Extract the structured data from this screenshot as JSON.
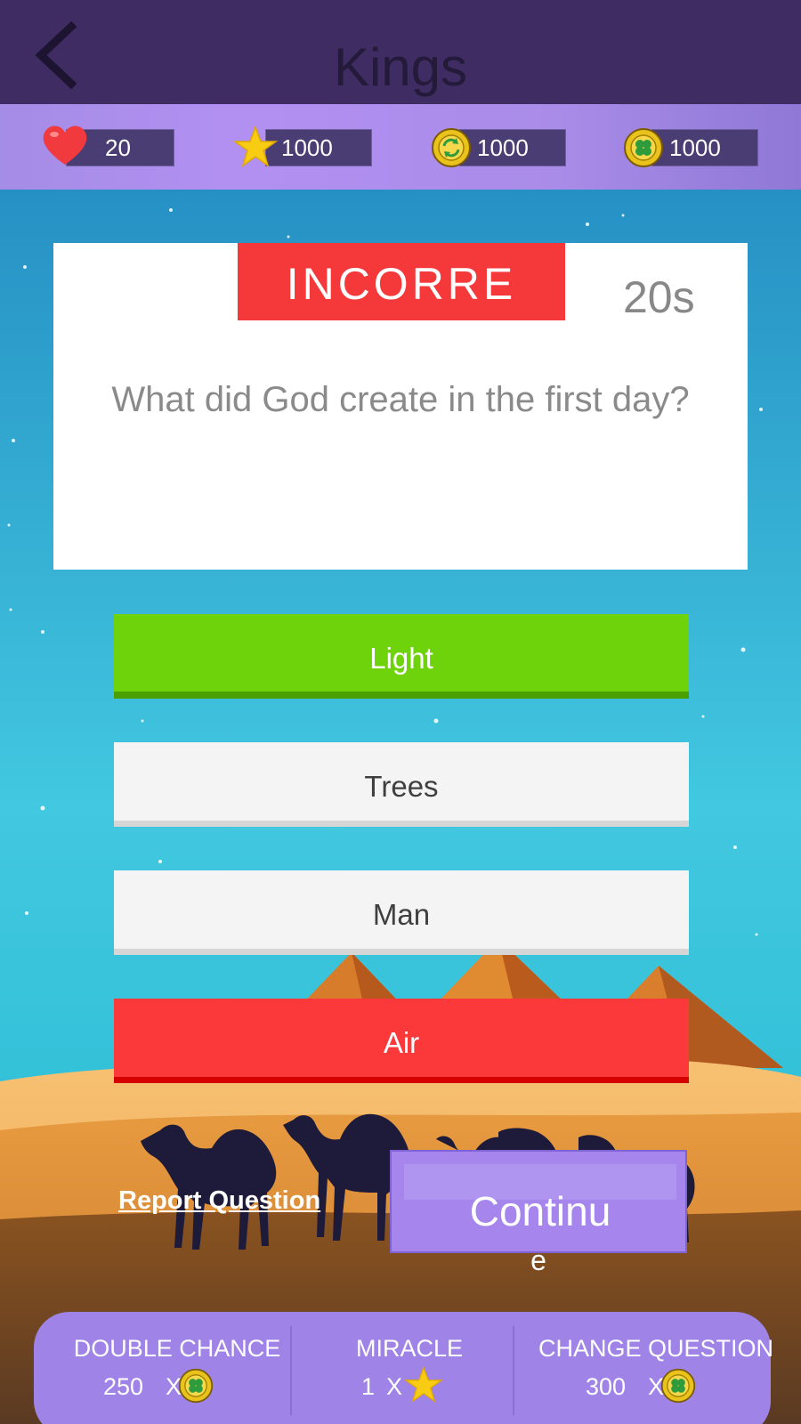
{
  "header": {
    "title": "Kings"
  },
  "stats": [
    {
      "icon": "heart-icon",
      "value": "20"
    },
    {
      "icon": "star-icon",
      "value": "1000"
    },
    {
      "icon": "refresh-coin-icon",
      "value": "1000"
    },
    {
      "icon": "clover-coin-icon",
      "value": "1000"
    }
  ],
  "question": {
    "verdict": "INCORRE",
    "timer": "20s",
    "text": "What did God create in the first day?"
  },
  "answers": [
    {
      "label": "Light",
      "state": "correct"
    },
    {
      "label": "Trees",
      "state": "neutral"
    },
    {
      "label": "Man",
      "state": "neutral"
    },
    {
      "label": "Air",
      "state": "wrong"
    }
  ],
  "actions": {
    "report_label": "Report Question",
    "continue_label": "Continu",
    "continue_overflow": "e"
  },
  "powerups": [
    {
      "name": "DOUBLE CHANCE",
      "cost": "250",
      "multiplier": "X",
      "icon": "clover-coin-icon"
    },
    {
      "name": "MIRACLE",
      "cost": "1",
      "multiplier": "X",
      "icon": "star-icon"
    },
    {
      "name": "CHANGE QUESTION",
      "cost": "300",
      "multiplier": "X",
      "icon": "clover-coin-icon"
    }
  ],
  "colors": {
    "header": "#3e2c63",
    "stats_bar": "#a98be8",
    "correct": "#6ed30a",
    "wrong": "#fb393b",
    "accent": "#a686ec"
  }
}
